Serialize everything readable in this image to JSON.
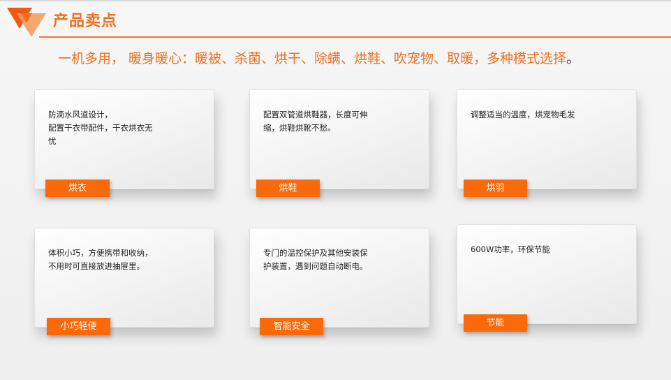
{
  "header": {
    "title": "产品卖点",
    "accent_color": "#f07020"
  },
  "tagline": {
    "text": "一机多用， 暖身暖心：暖被、杀菌、烘干、除螨、烘鞋、吹宠物、取暖，多种模式选择",
    "end_mark": "。"
  },
  "cards": [
    {
      "text": "防滴水风道设计，\n配置干衣带配件，干衣烘衣无\n忧",
      "tag": "烘衣"
    },
    {
      "text": "配置双管道烘鞋器，长度可伸\n缩，烘鞋烘靴不愁。",
      "tag": "烘鞋"
    },
    {
      "text": "调整适当的温度，烘宠物毛发",
      "tag": "烘羽"
    },
    {
      "text": "体积小巧，方便携带和收纳，\n不用时可直接放进抽屉里。",
      "tag": "小巧轻便"
    },
    {
      "text": "专门的温控保护及其他安装保\n护装置，遇到问题自动断电。",
      "tag": "智能安全"
    },
    {
      "text": "600W功率，环保节能",
      "tag": "节能"
    }
  ],
  "colors": {
    "tag_background": "#fb6a0a",
    "tag_text": "#ffffff"
  }
}
